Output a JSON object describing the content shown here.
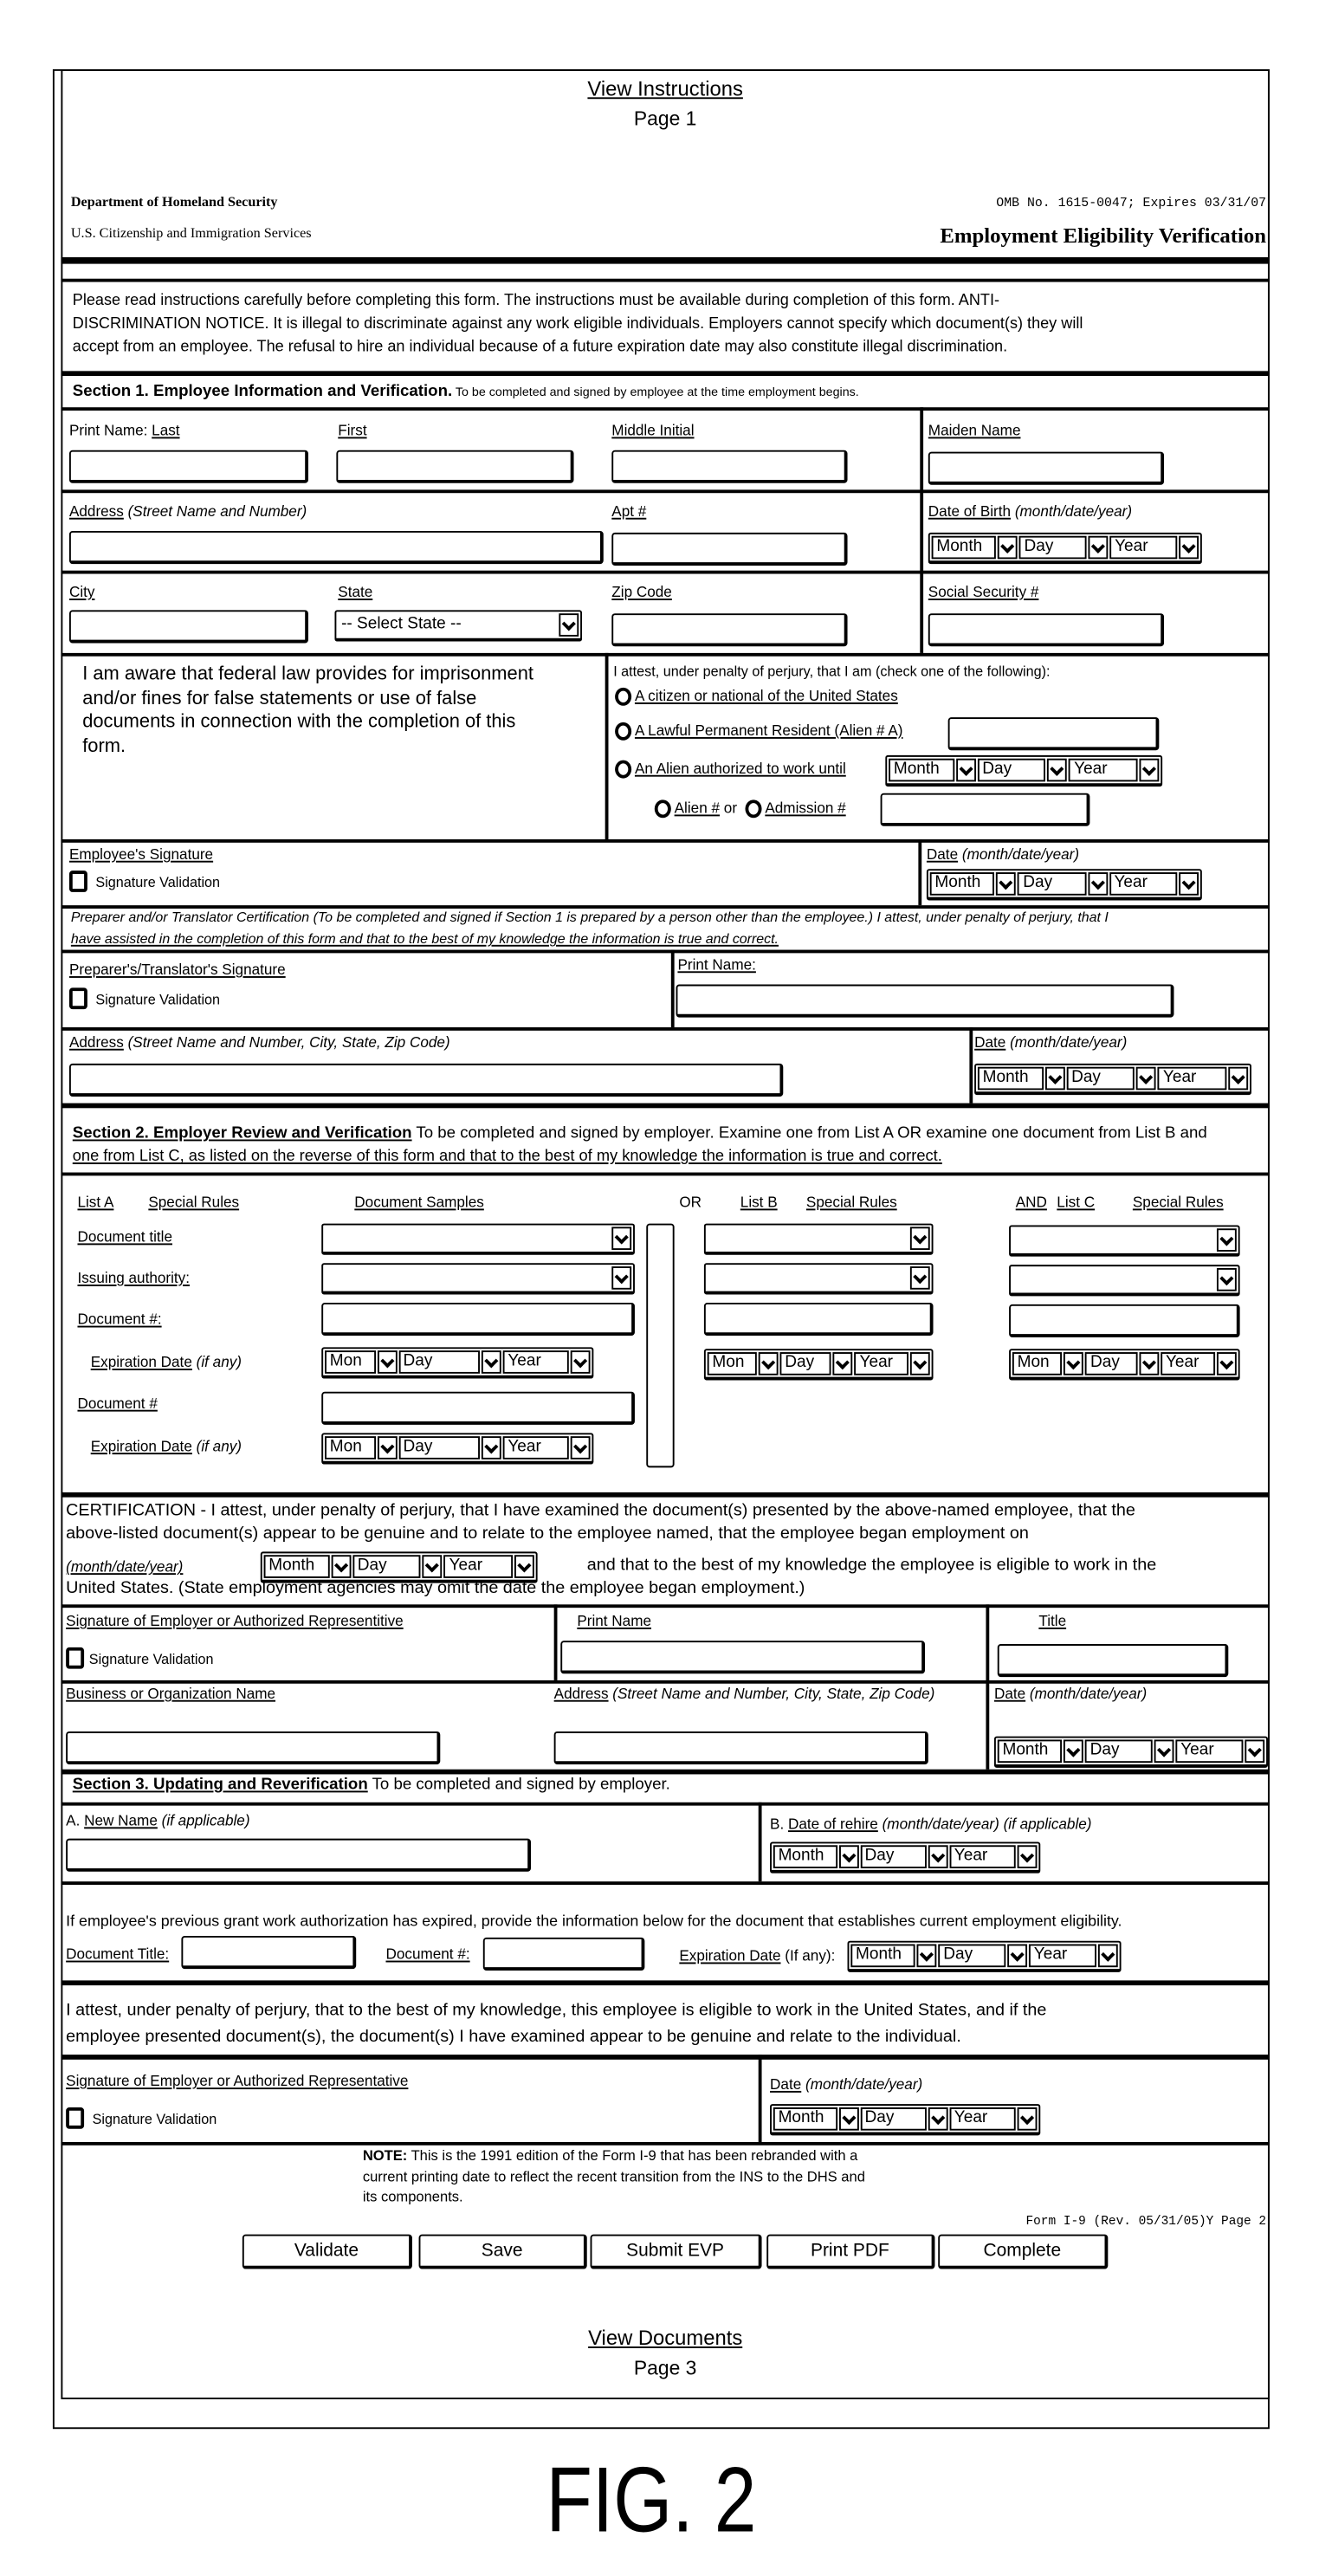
{
  "header": {
    "view_instructions": "View Instructions",
    "page_top": "Page 1",
    "agency_line1": "Department of Homeland Security",
    "agency_line2": "U.S. Citizenship and Immigration Services",
    "omb": "OMB No. 1615-0047; Expires 03/31/07",
    "form_title": "Employment Eligibility Verification"
  },
  "notice": {
    "lines": [
      "Please read instructions carefully before completing this form. The instructions must be available during completion of this form. ANTI-",
      "DISCRIMINATION NOTICE. It is illegal to discriminate against any work eligible individuals. Employers cannot specify which document(s) they will",
      "accept from an employee. The refusal to hire an individual because of a future expiration date may also constitute illegal discrimination."
    ]
  },
  "date": {
    "month": "Month",
    "month_short": "Mon",
    "day": "Day",
    "year": "Year"
  },
  "section1": {
    "title": "Section 1. Employee Information and Verification.",
    "subtitle": " To be completed and signed by employee at the time employment begins.",
    "print_name_prefix": "Print Name: ",
    "last": "Last",
    "first": "First",
    "middle_initial": "Middle Initial",
    "maiden_name": "Maiden Name",
    "address": "Address",
    "address_hint": " (Street Name and Number)",
    "apt": "Apt #",
    "dob": "Date of Birth",
    "date_hint": " (month/date/year)",
    "city": "City",
    "state": "State",
    "state_select": "-- Select State --",
    "zip": "Zip Code",
    "ssn": "Social Security #",
    "awareness_lines": [
      "I am aware that federal law provides for imprisonment",
      "and/or fines for false statements or use of false",
      "documents in connection with the completion of this",
      "form."
    ],
    "attest": "I attest, under penalty of perjury, that I am (check one of the following):",
    "option_citizen": "A citizen or national of the United States",
    "option_lpr": "A Lawful Permanent Resident (Alien # A)",
    "option_alien": "An Alien authorized to work until",
    "option_alien_number": "Alien #",
    "or": " or",
    "option_admission": "Admission #",
    "employee_signature": "Employee's Signature",
    "signature_validation": "Signature Validation",
    "date": "Date",
    "preparer_cert_lines": [
      "Preparer and/or Translator Certification (To be completed and signed if Section 1 is prepared by a person other than the employee.) I attest, under penalty of perjury, that I",
      "have assisted in the completion of this form and that to the best of my knowledge the information is true and correct."
    ],
    "preparer_signature": "Preparer's/Translator's Signature",
    "print_name": "Print Name:",
    "preparer_address": "Address",
    "preparer_address_hint": " (Street Name and Number, City, State, Zip Code)"
  },
  "section2": {
    "title": "Section 2. Employer Review and Verification",
    "desc_line1": " To be completed and signed by employer. Examine one from List A OR examine one document from List B and",
    "desc_line2": "one from List C, as listed on the reverse of this form and that to the best of my knowledge the information is true and correct.",
    "list_a": "List A",
    "special_rules": "Special Rules",
    "document_samples": "Document Samples",
    "or": "OR",
    "list_b": "List B",
    "and": "AND",
    "list_c": "List C",
    "document_title": "Document title",
    "issuing_authority": "Issuing authority:",
    "document_number": "Document #:",
    "expiration_date": "Expiration Date",
    "if_any": " (if any)",
    "document_number_2": "Document #",
    "certification_line1": "CERTIFICATION - I attest, under penalty of perjury, that I have examined the document(s) presented by the above-named employee, that the",
    "certification_line2": "above-listed document(s) appear to be genuine and to relate to the employee named, that the employee began employment on",
    "certification_date_label": "(month/date/year)",
    "certification_line3": "and that to the best of my knowledge the employee is eligible to work in the",
    "certification_line4": "United States. (State employment agencies may omit the date the employee began employment.)",
    "employer_signature": "Signature of Employer or Authorized Representitive",
    "signature_validation": "Signature Validation",
    "print_name": "Print Name",
    "title_label": "Title",
    "business_name": "Business or Organization Name",
    "address": "Address",
    "address_hint": " (Street Name and Number, City, State, Zip Code)",
    "date": "Date",
    "date_hint": " (month/date/year)"
  },
  "section3": {
    "title": "Section 3. Updating and Reverification",
    "subtitle": " To be completed and signed by employer.",
    "a_prefix": "A. ",
    "new_name": "New Name",
    "new_name_hint": " (if applicable)",
    "b_prefix": "B. ",
    "rehire": "Date of rehire",
    "rehire_hint": " (month/date/year) (if applicable)",
    "expired_text": "If employee's previous grant work authorization has expired, provide the information below for the document that establishes current employment eligibility.",
    "document_title": "Document Title:",
    "document_number": "Document #:",
    "expiration_date": "Expiration Date",
    "expiration_hint": " (If any):",
    "attest_line1": "I attest, under penalty of perjury, that to the best of my knowledge, this employee is eligible to work in the United States, and if the",
    "attest_line2": "employee presented document(s), the document(s) I have examined appear to be genuine and relate to the individual.",
    "signature": "Signature of Employer or Authorized Representative",
    "signature_validation": "Signature Validation",
    "date": "Date",
    "date_hint": " (month/date/year)"
  },
  "footer": {
    "note_label": "NOTE:",
    "note_line1": " This is the 1991 edition of the Form I-9 that has been rebranded with a",
    "note_line2": "current printing date to reflect the recent transition from the INS to the DHS and",
    "note_line3": "its components.",
    "form_revision": "Form I-9 (Rev. 05/31/05)Y Page 2",
    "buttons": [
      "Validate",
      "Save",
      "Submit EVP",
      "Print PDF",
      "Complete"
    ],
    "view_documents": "View Documents",
    "page_bottom": "Page 3"
  },
  "figure_label": "FIG. 2",
  "colors": {
    "ink": "#000000",
    "paper": "#ffffff"
  }
}
